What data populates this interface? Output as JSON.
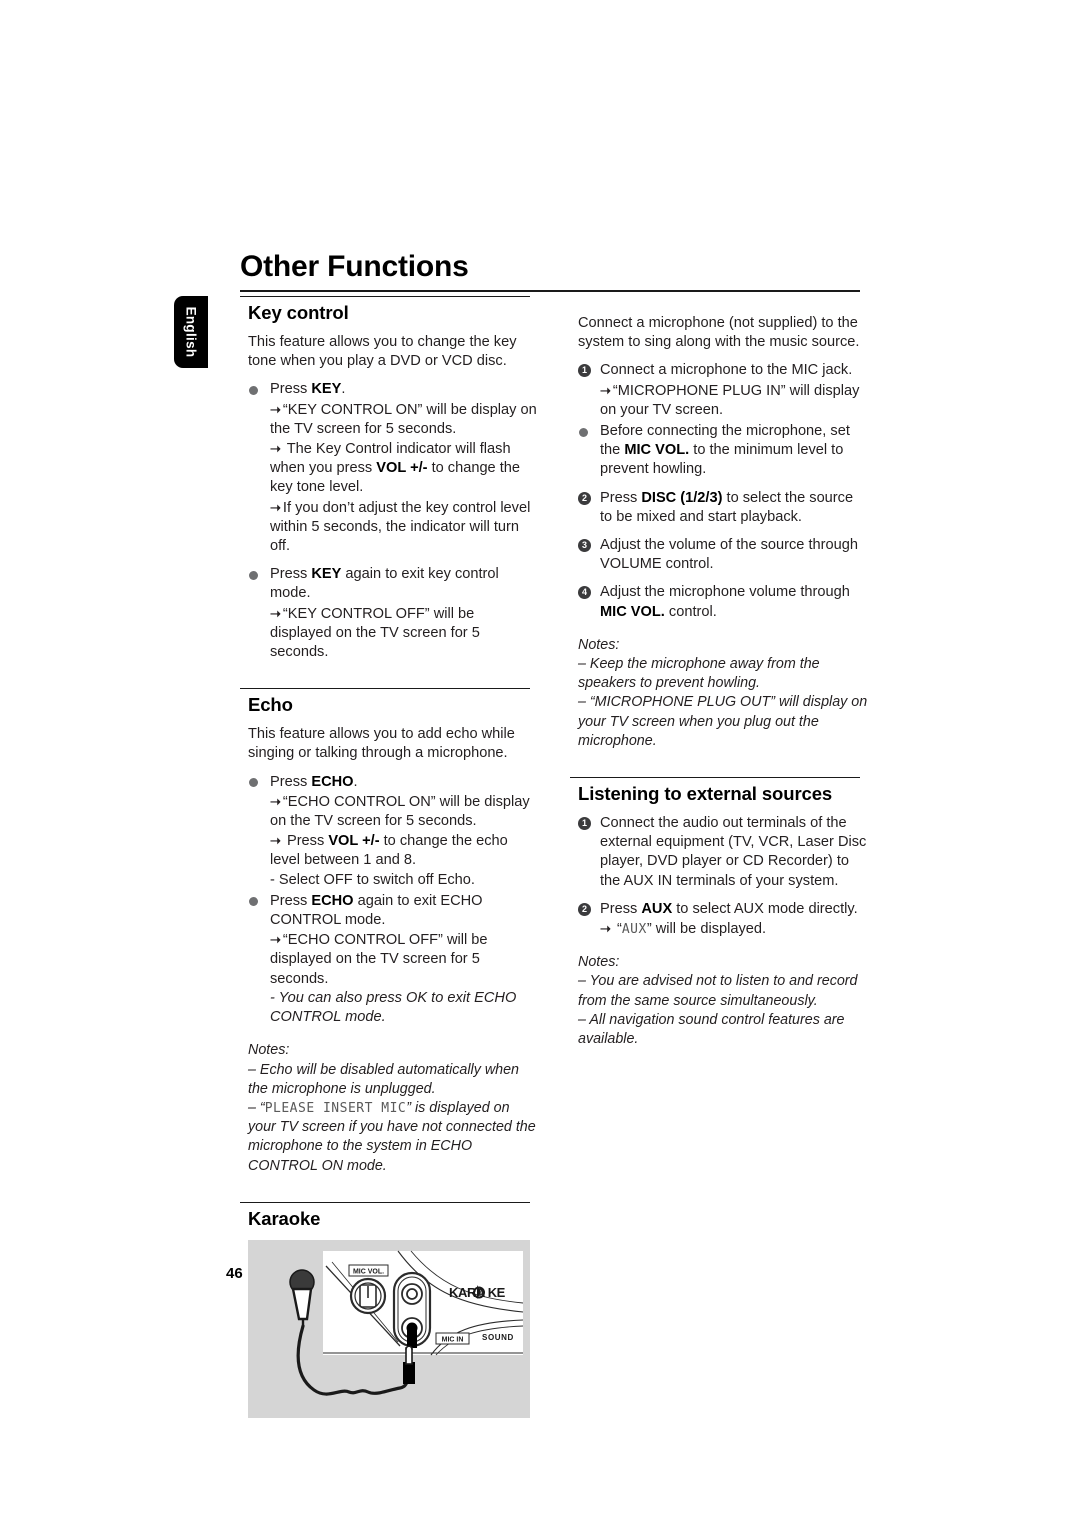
{
  "page": {
    "title": "Other Functions",
    "language_tab": "English",
    "page_number": "46"
  },
  "left_column": {
    "key_control": {
      "heading": "Key control",
      "intro": "This feature allows you to change the key tone when you play a DVD or VCD disc.",
      "items": [
        {
          "marker": "bullet",
          "text_lead": "Press ",
          "text_bold": "KEY",
          "text_tail": ".",
          "sub_lines": [
            "“KEY CONTROL ON” will be display on the TV screen for 5 seconds.",
            "The Key Control indicator will flash when you press VOL +/- to change the key tone level.",
            "If you don’t adjust the key control level within 5 seconds, the indicator will turn off."
          ]
        },
        {
          "marker": "bullet",
          "text_lead": " Press ",
          "text_bold": "KEY",
          "text_tail": " again to exit key control mode.",
          "sub_lines": [
            "“KEY CONTROL OFF” will be displayed on the TV screen for 5 seconds."
          ]
        }
      ]
    },
    "echo": {
      "heading": "Echo",
      "intro": "This feature allows you to add echo while singing or talking through a microphone.",
      "items": [
        {
          "marker": "bullet",
          "text_lead": "Press ",
          "text_bold": "ECHO",
          "text_tail": ".",
          "sub_lines": [
            "“ECHO CONTROL ON” will be display on the TV screen for 5 seconds.",
            "Press VOL +/- to change the echo level between 1 and 8.",
            "- Select OFF to switch off Echo."
          ]
        },
        {
          "marker": "bullet",
          "text_lead": "Press ",
          "text_bold": "ECHO",
          "text_tail": " again to exit ECHO CONTROL mode.",
          "sub_lines": [
            "“ECHO CONTROL OFF” will be displayed on the TV screen for 5 seconds.",
            "- You can also press OK to exit ECHO CONTROL mode."
          ]
        }
      ],
      "notes": {
        "label": "Notes:",
        "lines": [
          "–  Echo will be disabled automatically when the microphone is unplugged.",
          "–  “PLEASE INSERT MIC” is displayed on your TV screen if you have not connected the microphone to the system in ECHO CONTROL ON mode."
        ],
        "lcd_text": "PLEASE INSERT MIC"
      }
    },
    "karaoke": {
      "heading": "Karaoke",
      "illustration": {
        "label_mic_vol": "MIC VOL.",
        "label_mic_in": "MIC IN",
        "label_karaoke": "KARAOKE",
        "label_sound": "SOUND",
        "background_color": "#d5d5d5"
      }
    }
  },
  "right_column": {
    "microphone": {
      "intro": "Connect a microphone (not supplied) to the system to sing along with the music source.",
      "items": [
        {
          "marker": "1",
          "text": "Connect a microphone to the MIC jack.",
          "sub_lines": [
            "“MICROPHONE PLUG IN” will display on your TV screen."
          ]
        },
        {
          "marker": "bullet",
          "text_lead": "Before connecting the microphone, set the ",
          "text_bold": "MIC VOL.",
          "text_tail": " to the minimum level to prevent howling.",
          "sub_lines": []
        },
        {
          "marker": "2",
          "text_lead": "Press ",
          "text_bold": "DISC (1/2/3)",
          "text_tail": " to select the source to be mixed and start playback.",
          "sub_lines": []
        },
        {
          "marker": "3",
          "text": "Adjust the volume of the source through VOLUME control.",
          "sub_lines": []
        },
        {
          "marker": "4",
          "text_lead": "Adjust the microphone volume through ",
          "text_bold": "MIC VOL.",
          "text_tail": " control.",
          "sub_lines": []
        }
      ],
      "notes": {
        "label": "Notes:",
        "lines": [
          "–  Keep the microphone away from the speakers to prevent howling.",
          "–  “MICROPHONE PLUG OUT” will display on your TV screen when you plug out the microphone."
        ]
      }
    },
    "external_sources": {
      "heading": "Listening to external sources",
      "items": [
        {
          "marker": "1",
          "text": "Connect the audio out terminals of the external equipment (TV, VCR, Laser Disc player, DVD player or CD Recorder) to the AUX IN terminals of your system.",
          "sub_lines": []
        },
        {
          "marker": "2",
          "text_lead": "Press ",
          "text_bold": "AUX",
          "text_tail": " to select AUX mode directly.",
          "sub_lines": [
            "“AUX” will be displayed."
          ],
          "lcd_text": "AUX"
        }
      ],
      "notes": {
        "label": "Notes:",
        "lines": [
          "–  You are advised not to listen to and record from the same source simultaneously.",
          "–  All navigation sound control features are available."
        ]
      }
    }
  }
}
